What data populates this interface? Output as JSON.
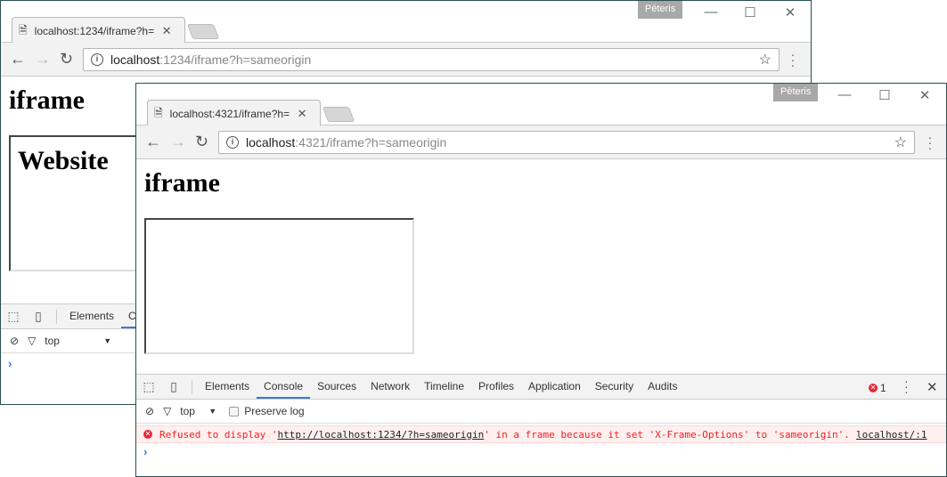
{
  "back_window": {
    "tab_title": "localhost:1234/iframe?h=",
    "user": "Pēteris",
    "url_host": "localhost",
    "url_rest": ":1234/iframe?h=sameorigin",
    "page_heading": "iframe",
    "iframe_heading": "Website",
    "devtools": {
      "tabs": [
        "Elements",
        "Co"
      ],
      "context": "top"
    }
  },
  "front_window": {
    "tab_title": "localhost:4321/iframe?h=",
    "user": "Pēteris",
    "url_host": "localhost",
    "url_rest": ":4321/iframe?h=sameorigin",
    "page_heading": "iframe",
    "devtools": {
      "tabs": [
        "Elements",
        "Console",
        "Sources",
        "Network",
        "Timeline",
        "Profiles",
        "Application",
        "Security",
        "Audits"
      ],
      "active_tab": "Console",
      "error_count": "1",
      "context": "top",
      "preserve_log": "Preserve log",
      "error": {
        "pre": "Refused to display '",
        "url": "http://localhost:1234/?h=sameorigin",
        "post": "' in a frame because it set 'X-Frame-Options' to 'sameorigin'.",
        "source": "localhost/:1"
      },
      "prompt": "›"
    }
  },
  "colors": {
    "accent": "#3879d9",
    "error": "#f02020",
    "window_border": "#2b4f4f"
  }
}
